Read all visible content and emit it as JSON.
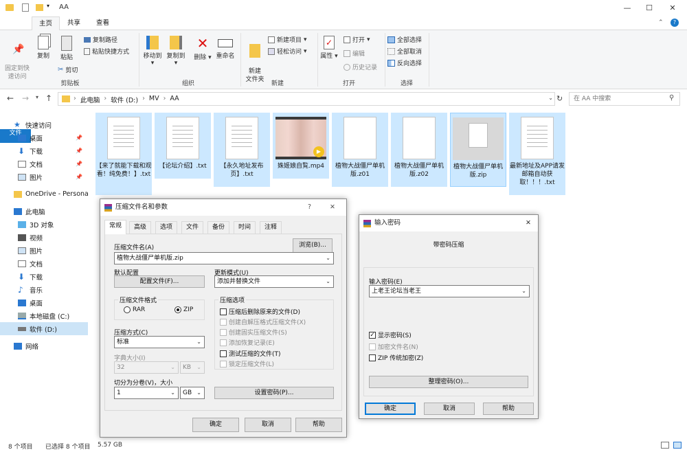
{
  "window": {
    "title": "AA"
  },
  "tabs": {
    "file": "文件",
    "home": "主页",
    "share": "共享",
    "view": "查看"
  },
  "ribbon": {
    "pin_quick": "固定到快\n速访问",
    "copy": "复制",
    "paste": "粘贴",
    "copy_path": "复制路径",
    "paste_shortcut": "粘贴快捷方式",
    "cut": "剪切",
    "group_clipboard": "剪贴板",
    "move_to": "移动到",
    "copy_to": "复制到",
    "delete": "删除",
    "rename": "重命名",
    "group_organize": "组织",
    "new_folder": "新建\n文件夹",
    "new_item": "新建项目",
    "easy_access": "轻松访问",
    "group_new": "新建",
    "properties": "属性",
    "open": "打开",
    "edit": "编辑",
    "history": "历史记录",
    "group_open": "打开",
    "select_all": "全部选择",
    "select_none": "全部取消",
    "invert": "反向选择",
    "group_select": "选择"
  },
  "address": {
    "path": [
      "此电脑",
      "软件 (D:)",
      "MV",
      "AA"
    ],
    "search_placeholder": "在 AA 中搜索"
  },
  "nav": [
    "快速访问",
    "桌面",
    "下载",
    "文档",
    "图片",
    "OneDrive - Persona",
    "此电脑",
    "3D 对象",
    "视频",
    "图片",
    "文档",
    "下载",
    "音乐",
    "桌面",
    "本地磁盘 (C:)",
    "软件 (D:)",
    "网络"
  ],
  "files": [
    {
      "name": "【来了就能下载和观看！纯免费！】.txt",
      "type": "txt"
    },
    {
      "name": "【论坛介绍】.txt",
      "type": "txt"
    },
    {
      "name": "【永久地址发布页】.txt",
      "type": "txt"
    },
    {
      "name": "姝姬娘自覧.mp4",
      "type": "video"
    },
    {
      "name": "植物大战僵尸单机版.z01",
      "type": "blank"
    },
    {
      "name": "植物大战僵尸单机版.z02",
      "type": "blank"
    },
    {
      "name": "植物大战僵尸单机版.zip",
      "type": "zip"
    },
    {
      "name": "最新地址及APP请发邮箱自动获取！！！.txt",
      "type": "txt"
    }
  ],
  "status": {
    "count": "8 个项目",
    "selected": "已选择 8 个项目",
    "size": "5.57 GB"
  },
  "zipdlg": {
    "title": "压缩文件名和参数",
    "help": "?",
    "tabs": [
      "常规",
      "高级",
      "选项",
      "文件",
      "备份",
      "时间",
      "注释"
    ],
    "name_label": "压缩文件名(A)",
    "browse": "浏览(B)...",
    "name_value": "植物大战僵尸单机版.zip",
    "default_label": "默认配置",
    "profiles": "配置文件(F)...",
    "update_label": "更新模式(U)",
    "update_value": "添加并替换文件",
    "format_label": "压缩文件格式",
    "rar": "RAR",
    "zip": "ZIP",
    "method_label": "压缩方式(C)",
    "method_value": "标准",
    "dict_label": "字典大小(I)",
    "dict_value": "32",
    "dict_unit": "KB",
    "split_label": "切分为分卷(V)，大小",
    "split_value": "1",
    "split_unit": "GB",
    "options_label": "压缩选项",
    "opt1": "压缩后删除原来的文件(D)",
    "opt2": "创建自解压格式压缩文件(X)",
    "opt3": "创建固实压缩文件(S)",
    "opt4": "添加恢复记录(E)",
    "opt5": "测试压缩的文件(T)",
    "opt6": "锁定压缩文件(L)",
    "set_password": "设置密码(P)...",
    "ok": "确定",
    "cancel": "取消",
    "helpbtn": "帮助"
  },
  "pwdlg": {
    "title": "输入密码",
    "heading": "带密码压缩",
    "label": "输入密码(E)",
    "value": "上老王论坛当老王",
    "show": "显示密码(S)",
    "encrypt_names": "加密文件名(N)",
    "zip_legacy": "ZIP 传统加密(Z)",
    "organize": "整理密码(O)...",
    "ok": "确定",
    "cancel": "取消",
    "help": "帮助"
  }
}
